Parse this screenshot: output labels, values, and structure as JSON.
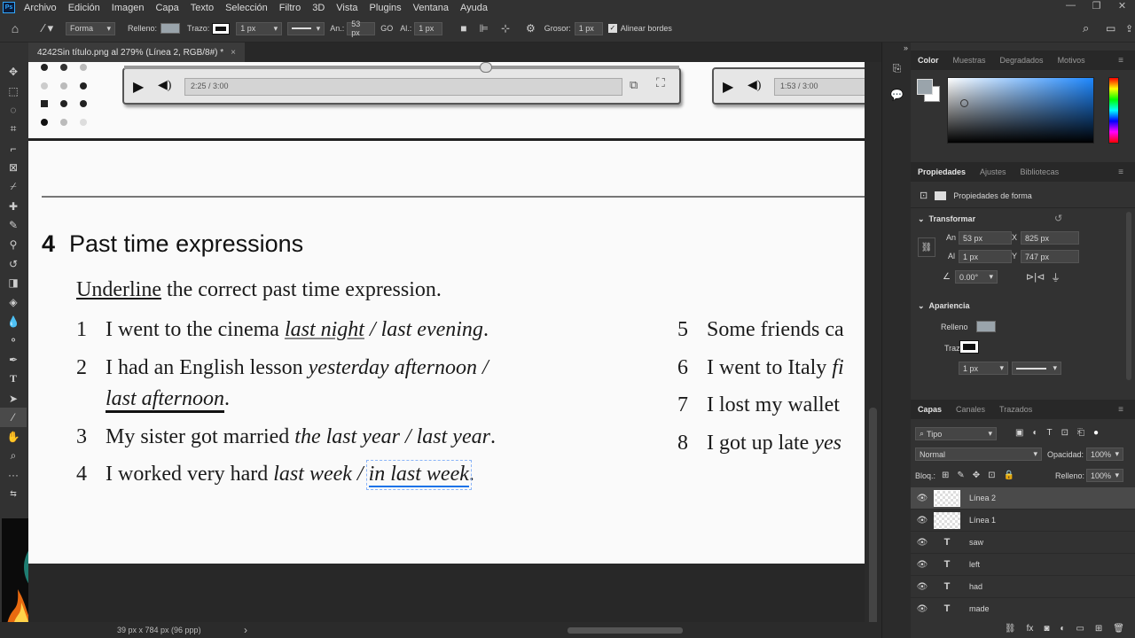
{
  "menubar": {
    "logo": "Ps",
    "items": [
      "Archivo",
      "Edición",
      "Imagen",
      "Capa",
      "Texto",
      "Selección",
      "Filtro",
      "3D",
      "Vista",
      "Plugins",
      "Ventana",
      "Ayuda"
    ],
    "window_controls": [
      "—",
      "❐",
      "✕"
    ]
  },
  "options": {
    "mode": "Forma",
    "fill_label": "Relleno:",
    "fill_color": "#9aa4ab",
    "stroke_label": "Trazo:",
    "stroke_width": "1 px",
    "width_label": "An.:",
    "width_value": "53 px",
    "link_label": "GO",
    "height_label": "Al.:",
    "height_value": "1 px",
    "weight_label": "Grosor:",
    "weight_value": "1 px",
    "align_edges": "Alinear bordes"
  },
  "document": {
    "tab_title": "4242Sin título.png al 279% (Línea 2, RGB/8#) *",
    "close": "×"
  },
  "status": {
    "dimensions": "39 px x 784 px (96 ppp)",
    "arrow": "›"
  },
  "worksheet": {
    "player1_time": "2:25 / 3:00",
    "player2_time": "1:53 / 3:00",
    "exercise_number": "4",
    "exercise_title": "Past time expressions",
    "instruction_underlined": "Underline",
    "instruction_rest": " the correct past time expression.",
    "items_left": [
      {
        "n": "1",
        "pre": "I went to the cinema ",
        "opt_a": "last night",
        "sep": " / ",
        "opt_b": "last evening",
        "end": "."
      },
      {
        "n": "2",
        "pre": "I had an English lesson ",
        "opt_a": "yesterday afternoon",
        "sep": " /",
        "opt_b": "",
        "end": ""
      },
      {
        "n": "",
        "pre": "",
        "opt_a": "last afternoon",
        "sep": "",
        "opt_b": "",
        "end": "."
      },
      {
        "n": "3",
        "pre": "My sister got married ",
        "opt_a": "the last year",
        "sep": " / ",
        "opt_b": "last year",
        "end": "."
      },
      {
        "n": "4",
        "pre": "I worked very hard ",
        "opt_a": "last week",
        "sep": " / ",
        "opt_b": "in last week",
        "end": "."
      }
    ],
    "items_right": [
      {
        "n": "5",
        "text": "Some friends ca"
      },
      {
        "n": "6",
        "text": "I went to Italy ",
        "italic": "fi"
      },
      {
        "n": "7",
        "text": "I lost my wallet"
      },
      {
        "n": "8",
        "text": "I got up late ",
        "italic": "yes"
      }
    ]
  },
  "color_panel": {
    "tabs": [
      "Color",
      "Muestras",
      "Degradados",
      "Motivos"
    ],
    "active_tab": "Color",
    "hue_color": "#1e88ff"
  },
  "properties_panel": {
    "tabs": [
      "Propiedades",
      "Ajustes",
      "Bibliotecas"
    ],
    "active_tab": "Propiedades",
    "header": "Propiedades de forma",
    "transform_label": "Transformar",
    "w_label": "An",
    "w_value": "53 px",
    "x_label": "X",
    "x_value": "825 px",
    "h_label": "Al",
    "h_value": "1 px",
    "y_label": "Y",
    "y_value": "747 px",
    "angle_value": "0.00°",
    "appearance_label": "Apariencia",
    "fill_label": "Relleno",
    "stroke_label": "Trazo",
    "stroke_width": "1 px"
  },
  "layers_panel": {
    "tabs": [
      "Capas",
      "Canales",
      "Trazados"
    ],
    "active_tab": "Capas",
    "filter": "Tipo",
    "blend_mode": "Normal",
    "opacity_label": "Opacidad:",
    "opacity_value": "100%",
    "lock_label": "Bloq.:",
    "fill_label": "Relleno:",
    "fill_value": "100%",
    "layers": [
      {
        "name": "Línea 2",
        "kind": "shape",
        "selected": true
      },
      {
        "name": "Línea 1",
        "kind": "shape",
        "selected": false
      },
      {
        "name": "saw",
        "kind": "text",
        "selected": false
      },
      {
        "name": "left",
        "kind": "text",
        "selected": false
      },
      {
        "name": "had",
        "kind": "text",
        "selected": false
      },
      {
        "name": "made",
        "kind": "text",
        "selected": false
      }
    ]
  }
}
